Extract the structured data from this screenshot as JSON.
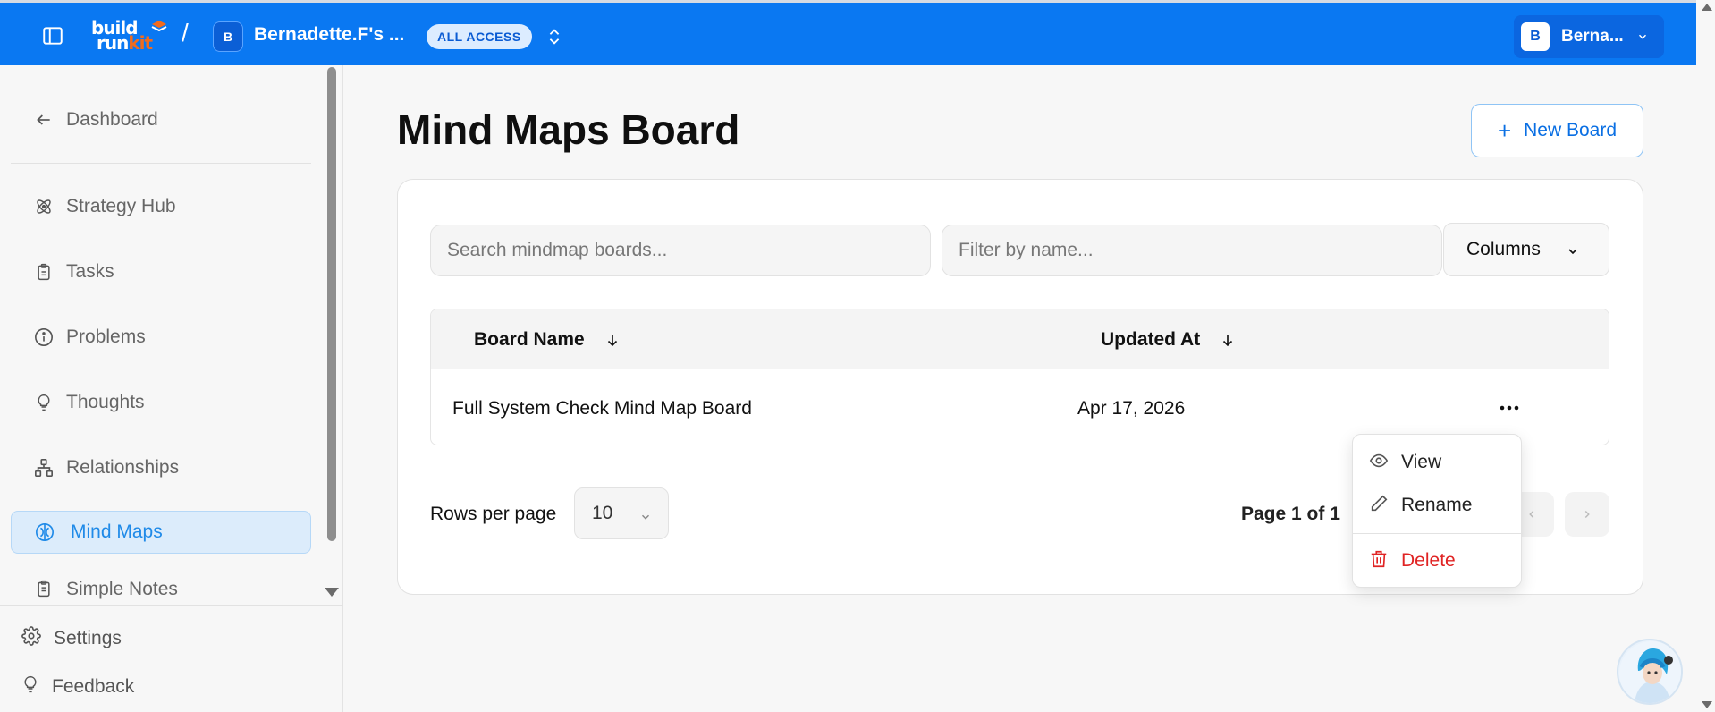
{
  "topbar": {
    "logo_line1": "build",
    "logo_line2": "run",
    "logo_kit": "kit",
    "separator": "/",
    "workspace_avatar": "B",
    "workspace_name": "Bernadette.F's ...",
    "access_badge": "ALL ACCESS",
    "user_avatar": "B",
    "user_name": "Berna..."
  },
  "sidebar": {
    "back": {
      "label": "Dashboard",
      "icon": "arrow-left-icon"
    },
    "items": [
      {
        "label": "Strategy Hub",
        "icon": "atom-icon"
      },
      {
        "label": "Tasks",
        "icon": "clipboard-icon"
      },
      {
        "label": "Problems",
        "icon": "info-icon"
      },
      {
        "label": "Thoughts",
        "icon": "lightbulb-icon"
      },
      {
        "label": "Relationships",
        "icon": "network-icon"
      },
      {
        "label": "Mind Maps",
        "icon": "brain-icon",
        "active": true
      },
      {
        "label": "Simple Notes",
        "icon": "notes-icon"
      }
    ],
    "footer": [
      {
        "label": "Settings",
        "icon": "gear-icon"
      },
      {
        "label": "Feedback",
        "icon": "lightbulb-icon"
      }
    ]
  },
  "main": {
    "title": "Mind Maps Board",
    "new_board_label": "New Board",
    "search_placeholder": "Search mindmap boards...",
    "filter_placeholder": "Filter by name...",
    "columns_label": "Columns",
    "table": {
      "headers": [
        "Board Name",
        "Updated At"
      ],
      "rows": [
        {
          "name": "Full System Check Mind Map Board",
          "updated": "Apr 17, 2026"
        }
      ]
    },
    "rows_per_page_label": "Rows per page",
    "rows_per_page_value": "10",
    "page_info": "Page 1 of 1"
  },
  "row_menu": {
    "items": [
      {
        "label": "View",
        "icon": "eye-icon"
      },
      {
        "label": "Rename",
        "icon": "pencil-icon"
      },
      {
        "label": "Delete",
        "icon": "trash-icon"
      }
    ]
  },
  "colors": {
    "brand_blue": "#0a78f2",
    "accent_orange": "#f26b1d",
    "active_bg": "#dcecfb",
    "danger": "#e02424"
  }
}
